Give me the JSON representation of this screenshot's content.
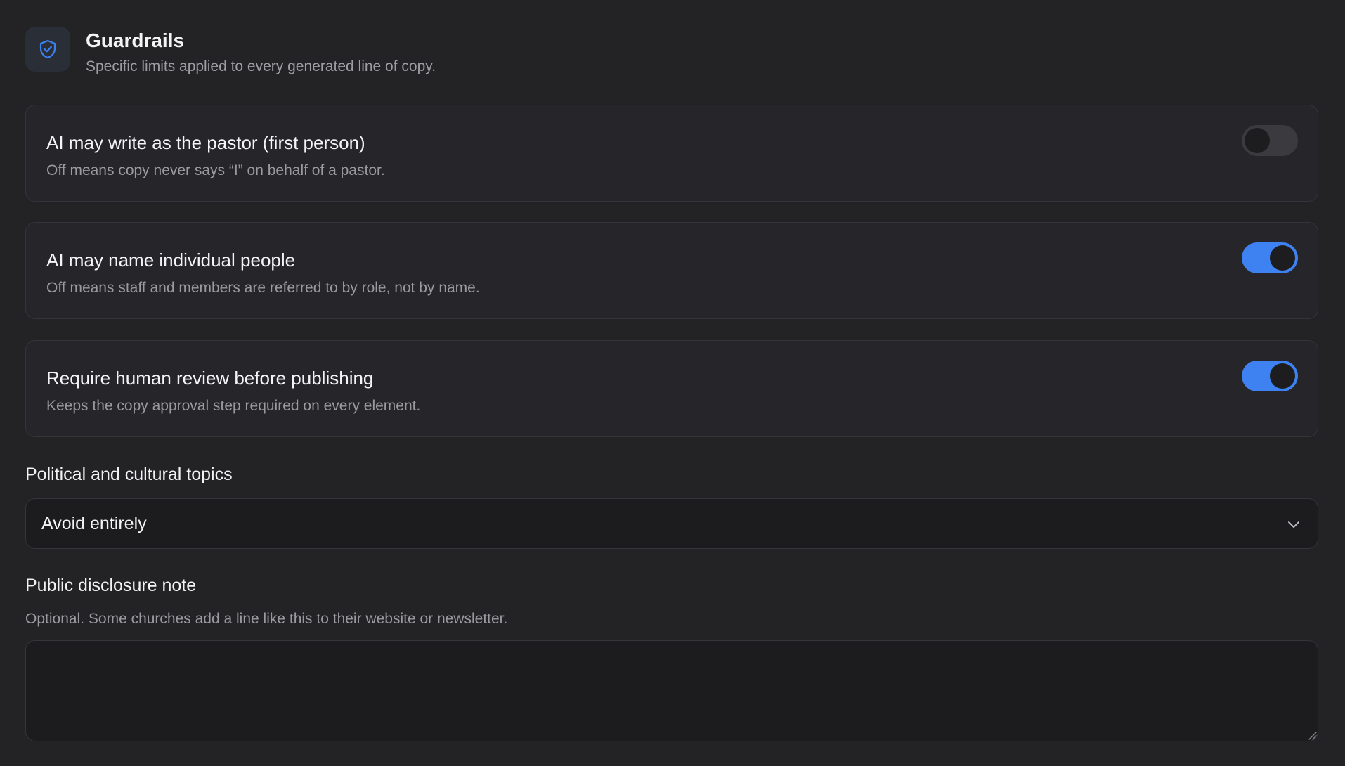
{
  "header": {
    "icon": "shield-check-icon",
    "title": "Guardrails",
    "subtitle": "Specific limits applied to every generated line of copy."
  },
  "settings": [
    {
      "title": "AI may write as the pastor (first person)",
      "description": "Off means copy never says “I” on behalf of a pastor.",
      "enabled": false
    },
    {
      "title": "AI may name individual people",
      "description": "Off means staff and members are referred to by role, not by name.",
      "enabled": true
    },
    {
      "title": "Require human review before publishing",
      "description": "Keeps the copy approval step required on every element.",
      "enabled": true
    }
  ],
  "political_topics": {
    "label": "Political and cultural topics",
    "selected": "Avoid entirely",
    "icon": "chevron-down-icon"
  },
  "disclosure": {
    "label": "Public disclosure note",
    "helper": "Optional. Some churches add a line like this to their website or newsletter.",
    "value": ""
  },
  "colors": {
    "accent": "#3d82f0",
    "background": "#232326",
    "card": "#26262a",
    "field": "#1c1c1f"
  }
}
